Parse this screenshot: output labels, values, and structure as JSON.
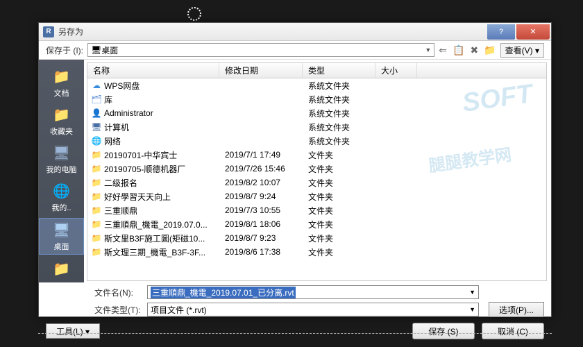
{
  "dialog": {
    "title": "另存为",
    "save_in_label": "保存于 (I):",
    "location": "桌面",
    "view_btn": "查看(V)",
    "filename_label": "文件名(N):",
    "filename_value": "三重順鼎_機電_2019.07.01_已分离.rvt",
    "filetype_label": "文件类型(T):",
    "filetype_value": "项目文件 (*.rvt)",
    "options_btn": "选项(P)...",
    "tools_btn": "工具(L)",
    "save_btn": "保存 (S)",
    "cancel_btn": "取消 (C)"
  },
  "columns": {
    "name": "名称",
    "date": "修改日期",
    "type": "类型",
    "size": "大小"
  },
  "sidebar": [
    {
      "label": "文档",
      "icon": "📁"
    },
    {
      "label": "收藏夹",
      "icon": "📁"
    },
    {
      "label": "我的电脑",
      "icon": "🖥"
    },
    {
      "label": "我的..",
      "icon": "🌐"
    },
    {
      "label": "桌面",
      "icon": "🖥"
    },
    {
      "label": "",
      "icon": "📁"
    }
  ],
  "files": [
    {
      "icon": "cloud",
      "name": "WPS网盘",
      "date": "",
      "type": "系统文件夹"
    },
    {
      "icon": "lib",
      "name": "库",
      "date": "",
      "type": "系统文件夹"
    },
    {
      "icon": "user",
      "name": "Administrator",
      "date": "",
      "type": "系统文件夹"
    },
    {
      "icon": "comp",
      "name": "计算机",
      "date": "",
      "type": "系统文件夹"
    },
    {
      "icon": "net",
      "name": "网络",
      "date": "",
      "type": "系统文件夹"
    },
    {
      "icon": "folder",
      "name": "20190701-中华宾士",
      "date": "2019/7/1 17:49",
      "type": "文件夹"
    },
    {
      "icon": "folder",
      "name": "20190705-顺德机器厂",
      "date": "2019/7/26 15:46",
      "type": "文件夹"
    },
    {
      "icon": "folder",
      "name": "二级报名",
      "date": "2019/8/2 10:07",
      "type": "文件夹"
    },
    {
      "icon": "folder",
      "name": "好好學習天天向上",
      "date": "2019/8/7 9:24",
      "type": "文件夹"
    },
    {
      "icon": "folder",
      "name": "三重顺鼎",
      "date": "2019/7/3 10:55",
      "type": "文件夹"
    },
    {
      "icon": "folder-g",
      "name": "三重順鼎_機電_2019.07.0...",
      "date": "2019/8/1 18:06",
      "type": "文件夹"
    },
    {
      "icon": "folder-g",
      "name": "斯文里B3F施工圖(矩磁10...",
      "date": "2019/8/7 9:23",
      "type": "文件夹"
    },
    {
      "icon": "folder-g",
      "name": "斯文理三期_機電_B3F-3F...",
      "date": "2019/8/6 17:38",
      "type": "文件夹"
    }
  ],
  "watermark1": "SOFT",
  "watermark2": "腿腿教学网"
}
